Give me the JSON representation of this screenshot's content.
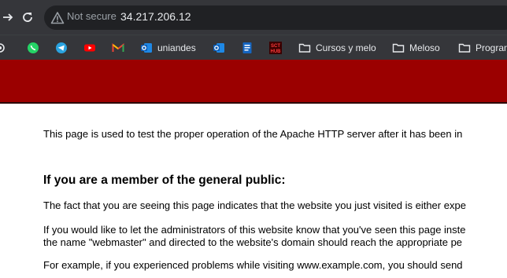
{
  "browser": {
    "not_secure_label": "Not secure",
    "url": "34.217.206.12",
    "bookmarks": [
      {
        "icon": "whatsapp-icon",
        "label": ""
      },
      {
        "icon": "telegram-icon",
        "label": ""
      },
      {
        "icon": "youtube-icon",
        "label": ""
      },
      {
        "icon": "gmail-icon",
        "label": ""
      },
      {
        "icon": "outlook-icon",
        "label": "uniandes"
      },
      {
        "icon": "outlook-icon",
        "label": ""
      },
      {
        "icon": "document-icon",
        "label": ""
      },
      {
        "icon": "sct-hub-icon",
        "label": ""
      },
      {
        "icon": "folder-icon",
        "label": "Cursos y melo"
      },
      {
        "icon": "folder-icon",
        "label": "Meloso"
      },
      {
        "icon": "folder-icon",
        "label": "Program"
      }
    ],
    "sct_text": "SCT",
    "hub_text": "HUB"
  },
  "page": {
    "banner_color": "#9b0000",
    "intro": "This page is used to test the proper operation of the Apache HTTP server after it has been in",
    "heading_public": "If you are a member of the general public:",
    "para_fact": "The fact that you are seeing this page indicates that the website you just visited is either expe",
    "para_admin_1": "If you would like to let the administrators of this website know that you've seen this page inste",
    "para_admin_2": "the name \"webmaster\" and directed to the website's domain should reach the appropriate pe",
    "para_example": "For example, if you experienced problems while visiting www.example.com, you should send"
  }
}
